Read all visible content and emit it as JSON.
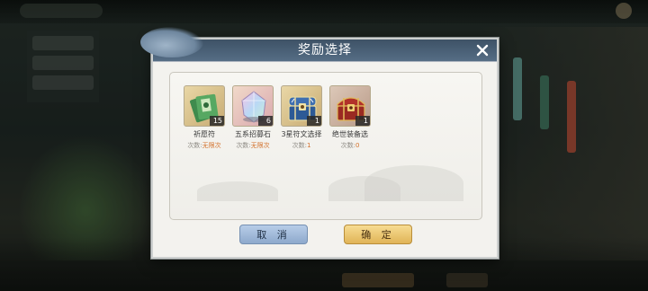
{
  "dialog": {
    "title": "奖励选择",
    "cancel_label": "取 消",
    "confirm_label": "确 定"
  },
  "rewards": [
    {
      "name": "祈愿符",
      "count": "15",
      "times_label": "次数:",
      "times_value": "无限次",
      "icon": "green-talisman-bundle-icon"
    },
    {
      "name": "五系招募石",
      "count": "6",
      "times_label": "次数:",
      "times_value": "无限次",
      "icon": "prismatic-crystal-icon"
    },
    {
      "name": "3星符文选择",
      "count": "1",
      "times_label": "次数:",
      "times_value": "1",
      "icon": "blue-rune-chest-icon"
    },
    {
      "name": "绝世装备选",
      "count": "1",
      "times_label": "次数:",
      "times_value": "0",
      "icon": "red-gold-treasure-chest-icon"
    }
  ],
  "colors": {
    "header": "#4a6077",
    "accent_orange": "#d2702b",
    "cancel_button": "#a3bcdd",
    "confirm_button": "#eec875"
  }
}
